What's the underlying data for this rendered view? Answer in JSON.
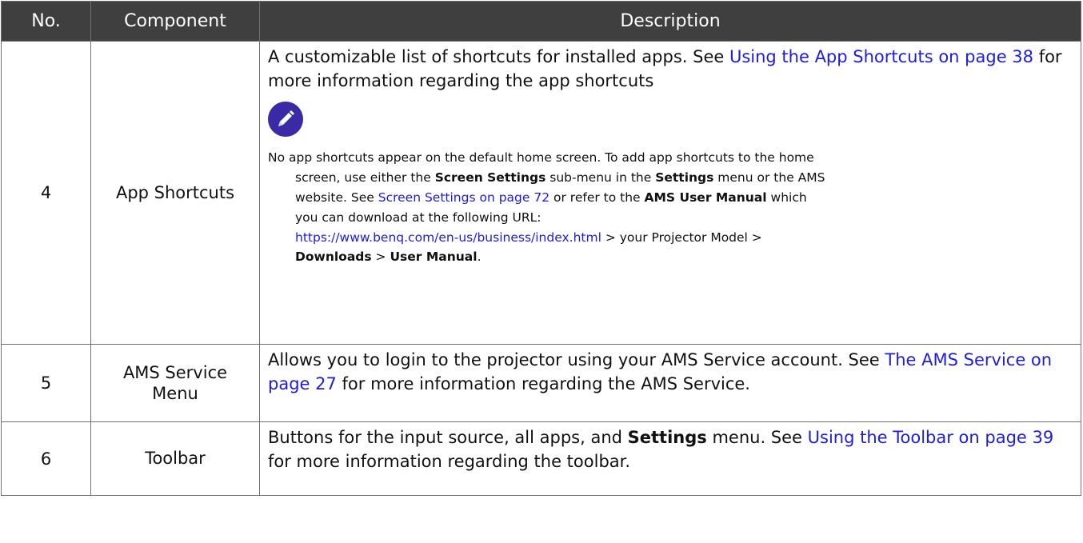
{
  "headers": {
    "no": "No.",
    "component": "Component",
    "description": "Description"
  },
  "rows": [
    {
      "no": "4",
      "component": "App Shortcuts",
      "desc_a": "A customizable list of shortcuts for installed apps. See ",
      "desc_link": "Using the App Shortcuts on page 38",
      "desc_b": " for more information regarding the app shortcuts",
      "note_icon": "pencil-note-icon",
      "note": {
        "l1": "No app shortcuts appear on the default home screen. To add app shortcuts to the home",
        "l2a": "screen, use either the ",
        "l2b": "Screen Settings",
        "l2c": " sub-menu in the ",
        "l2d": "Settings",
        "l2e": " menu or the AMS",
        "l3a": "website. See ",
        "l3link": "Screen Settings on page 72",
        "l3b": " or refer to the ",
        "l3c": "AMS User Manual",
        "l3d": " which",
        "l4": "you can download at the following URL:",
        "l5link": "https://www.benq.com/en-us/business/index.html",
        "l5b": " > your Projector Model >",
        "l6a": "Downloads",
        "l6b": " > ",
        "l6c": "User Manual",
        "l6d": "."
      }
    },
    {
      "no": "5",
      "component": "AMS Service Menu",
      "desc_a": "Allows you to login to the projector using your AMS Service account. See ",
      "desc_link": "The AMS Service on page 27",
      "desc_b": " for more information regarding the AMS Service."
    },
    {
      "no": "6",
      "component": "Toolbar",
      "desc_a": "Buttons for the input source, all apps, and ",
      "desc_bold": "Settings",
      "desc_b": " menu. See ",
      "desc_link": "Using the Toolbar on page 39",
      "desc_c": " for more information regarding the toolbar."
    }
  ],
  "colors": {
    "header_bg": "#3f3f3f",
    "link": "#1c1ce6",
    "icon_bg": "#3b2aa6"
  }
}
